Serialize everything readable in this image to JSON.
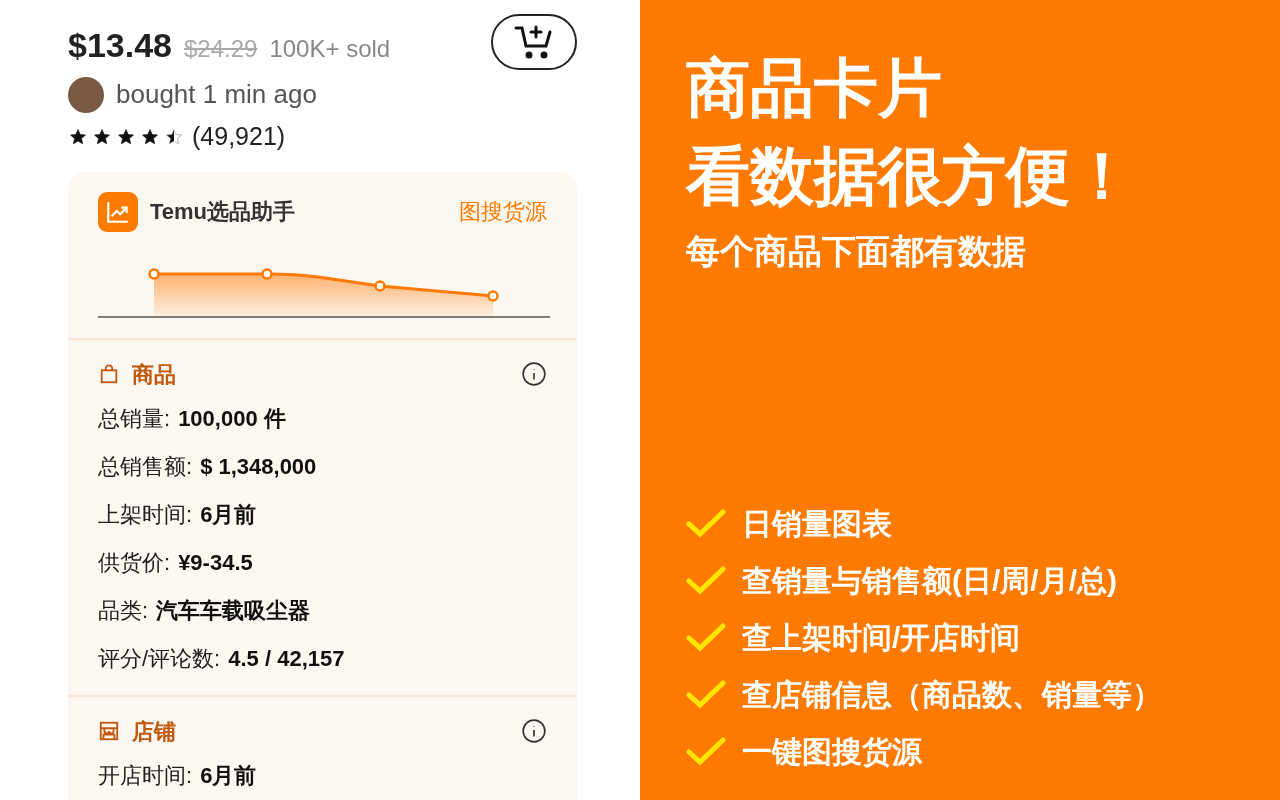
{
  "product": {
    "price": "$13.48",
    "original_price": "$24.29",
    "sold": "100K+ sold",
    "recent_purchase": "bought 1 min ago",
    "stars": 4.5,
    "review_count": "(49,921)"
  },
  "assistant_card": {
    "title": "Temu选品助手",
    "image_search_link": "图搜货源",
    "sections": [
      {
        "kind": "product",
        "title": "商品",
        "rows": [
          {
            "label": "总销量:",
            "value": "100,000 件"
          },
          {
            "label": "总销售额:",
            "value": "$ 1,348,000"
          },
          {
            "label": "上架时间:",
            "value": "6月前"
          },
          {
            "label": "供货价:",
            "value": "¥9-34.5"
          },
          {
            "label": "品类:",
            "value": "汽车车载吸尘器"
          },
          {
            "label": "评分/评论数:",
            "value": "4.5 / 42,157"
          }
        ]
      },
      {
        "kind": "store",
        "title": "店铺",
        "rows": [
          {
            "label": "开店时间:",
            "value": "6月前"
          }
        ]
      }
    ]
  },
  "promo": {
    "headline": [
      "商品卡片",
      "看数据很方便！"
    ],
    "subtitle": "每个商品下面都有数据",
    "features": [
      "日销量图表",
      "查销量与销售额(日/周/月/总)",
      "查上架时间/开店时间",
      "查店铺信息（商品数、销量等）",
      "一键图搜货源"
    ]
  }
}
